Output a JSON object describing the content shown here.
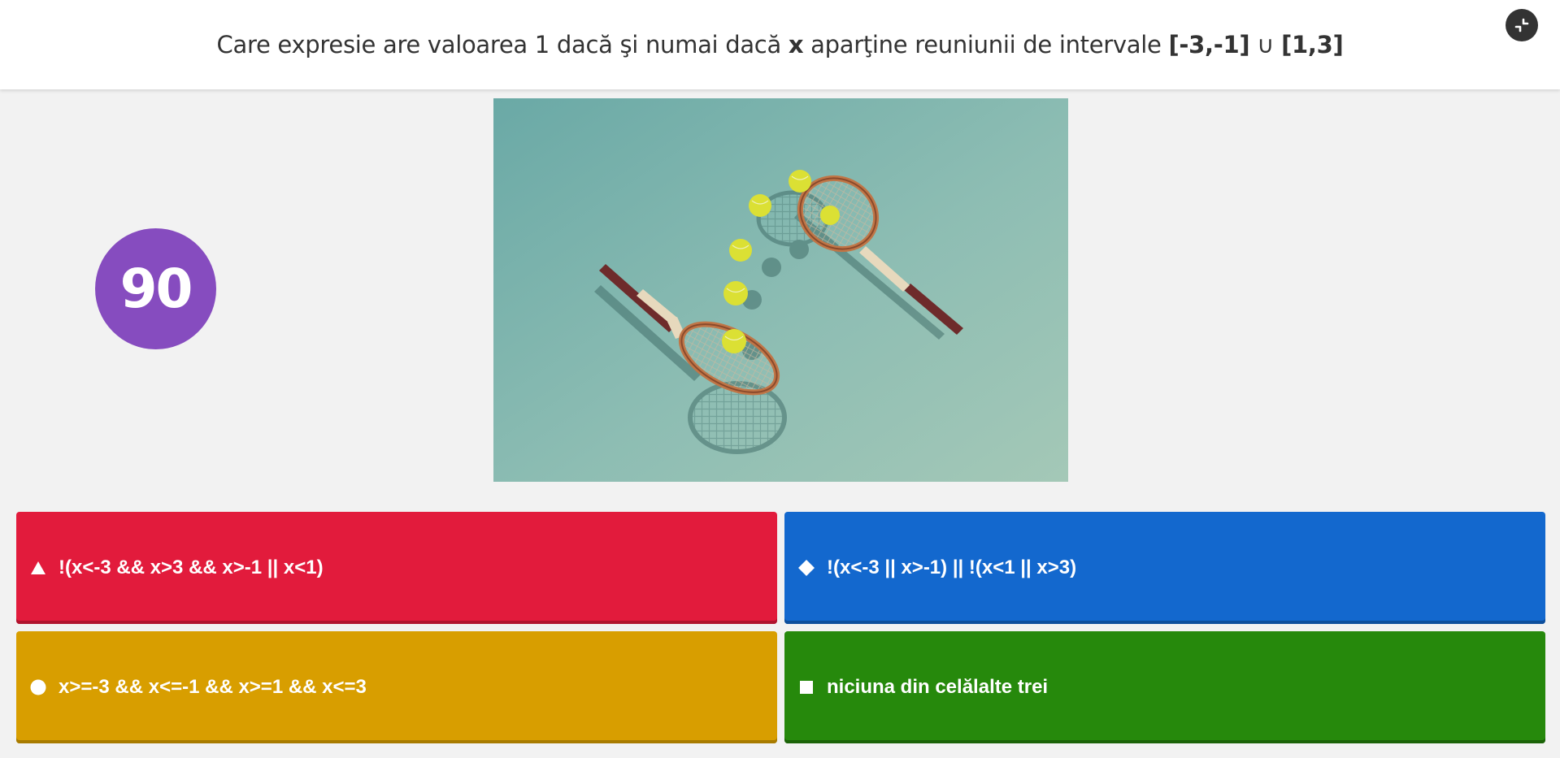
{
  "question": {
    "prefix": "Care expresie are valoarea 1 dacă şi numai dacă ",
    "var": "x",
    "middle": " aparţine reuniunii de intervale ",
    "interval1": "[-3,-1]",
    "union": " ∪ ",
    "interval2": "[1,3]"
  },
  "timer": {
    "value": "90",
    "color": "#864cbf"
  },
  "fullscreen": {
    "icon": "fullscreen-exit-icon"
  },
  "media": {
    "image": "tennis-rackets-and-balls"
  },
  "answers": [
    {
      "shape": "triangle-icon",
      "color": "#e21b3c",
      "text": "!(x<-3 && x>3 && x>-1 || x<1)"
    },
    {
      "shape": "diamond-icon",
      "color": "#1368ce",
      "text": "!(x<-3 || x>-1) || !(x<1 || x>3)"
    },
    {
      "shape": "circle-icon",
      "color": "#d89e00",
      "text": "x>=-3 && x<=-1 && x>=1 && x<=3"
    },
    {
      "shape": "square-icon",
      "color": "#26890c",
      "text": "niciuna din celălalte trei"
    }
  ]
}
